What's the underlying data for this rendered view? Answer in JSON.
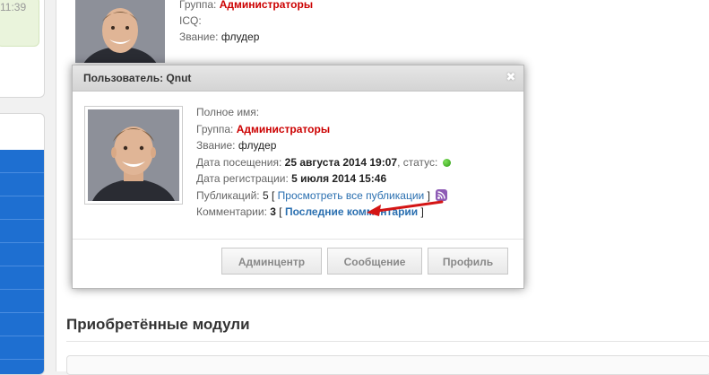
{
  "sidebar": {
    "time": "11:39"
  },
  "background_profile": {
    "group_label": "Группа:",
    "group_value": "Администраторы",
    "icq_label": "ICQ:",
    "rank_label": "Звание:",
    "rank_value": "флудер"
  },
  "section": {
    "title": "Приобретённые модули"
  },
  "popup": {
    "title": "Пользователь: Qnut",
    "close_glyph": "✖",
    "fullname_label": "Полное имя:",
    "group_label": "Группа:",
    "group_value": "Администраторы",
    "rank_label": "Звание:",
    "rank_value": "флудер",
    "visit_label": "Дата посещения:",
    "visit_value": "25 августа 2014 19:07",
    "status_label": ", статус:",
    "reg_label": "Дата регистрации:",
    "reg_value": "5 июля 2014 15:46",
    "pubs_label": "Публикаций:",
    "pubs_count": "5",
    "bracket_open": "[",
    "bracket_close": "]",
    "pubs_link": "Просмотреть все публикации",
    "comments_label": "Комментарии:",
    "comments_count": "3",
    "comments_link": "Последние комментарии",
    "buttons": {
      "admin": "Админцентр",
      "message": "Сообщение",
      "profile": "Профиль"
    }
  },
  "colors": {
    "accent_red": "#cc0000",
    "link_blue": "#2a6fb0",
    "status_online": "#2f9a16",
    "rss": "#8e5bb5",
    "sidebar_blue": "#1e6fd1"
  },
  "icons": [
    "close-icon",
    "status-online-icon",
    "rss-icon",
    "arrow-annotation-icon"
  ]
}
